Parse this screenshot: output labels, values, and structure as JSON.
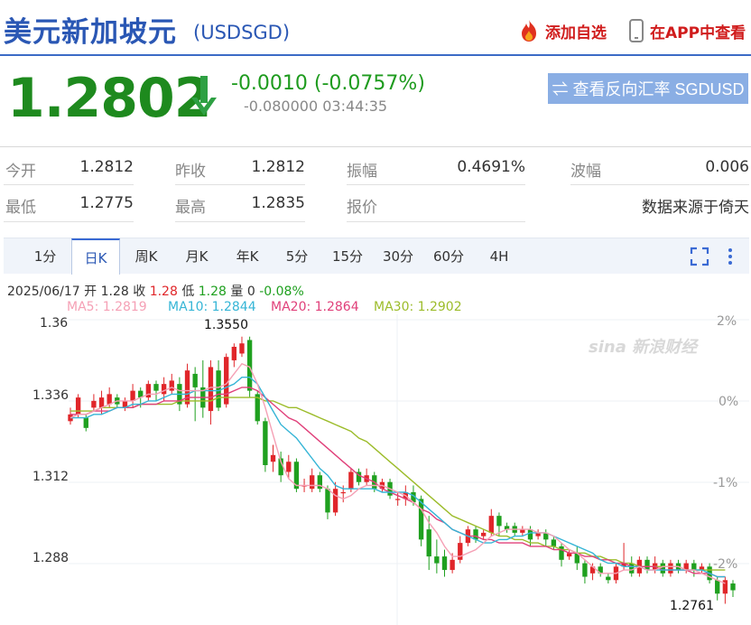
{
  "header": {
    "title": "美元新加坡元",
    "symbol": "(USDSGD)",
    "add_favorite": "添加自选",
    "open_app": "在APP中查看"
  },
  "quote": {
    "price": "1.2802",
    "change": "-0.0010 (-0.0757%)",
    "sub_line": "-0.080000 03:44:35",
    "reverse_button": "⇌ 查看反向汇率 SGDUSD",
    "down_color": "#1e8a1e"
  },
  "stats": {
    "open_label": "今开",
    "open_value": "1.2812",
    "prev_label": "昨收",
    "prev_value": "1.2812",
    "amp_label": "振幅",
    "amp_value": "0.4691%",
    "vol_label": "波幅",
    "vol_value": "0.006",
    "low_label": "最低",
    "low_value": "1.2775",
    "high_label": "最高",
    "high_value": "1.2835",
    "quote_label": "报价",
    "source": "数据来源于倚天"
  },
  "tabs": [
    "1分",
    "日K",
    "周K",
    "月K",
    "年K",
    "5分",
    "15分",
    "30分",
    "60分",
    "4H"
  ],
  "active_tab": "日K",
  "chart_info": {
    "date": "2025/06/17",
    "open_label": "开",
    "open": "1.28",
    "close_label": "收",
    "close": "1.28",
    "low_label": "低",
    "low": "1.28",
    "volume_label": "量",
    "volume": "0",
    "change": "-0.08%"
  },
  "ma_labels": {
    "ma5": "MA5: 1.2819",
    "ma10": "MA10: 1.2844",
    "ma20": "MA20: 1.2864",
    "ma30": "MA30: 1.2902"
  },
  "colors": {
    "up": "#e0262a",
    "down": "#1fa01f",
    "ma5": "#f5a0b5",
    "ma10": "#35b5d6",
    "ma20": "#e0407a",
    "ma30": "#9cbc2a"
  },
  "watermark": "sina 新浪财经",
  "chart_data": {
    "type": "candlestick",
    "y_ticks": [
      "1.36",
      "1.336",
      "1.312",
      "1.288"
    ],
    "right_ticks": [
      "2%",
      "0%",
      "-1%",
      "-2%"
    ],
    "ylim": [
      1.274,
      1.36
    ],
    "max_label": "1.3550",
    "min_label": "1.2761",
    "candles": [
      [
        1.33,
        1.332,
        1.329,
        1.334
      ],
      [
        1.332,
        1.337,
        1.331,
        1.338
      ],
      [
        1.331,
        1.328,
        1.327,
        1.332
      ],
      [
        1.334,
        1.336,
        1.333,
        1.338
      ],
      [
        1.334,
        1.337,
        1.332,
        1.339
      ],
      [
        1.335,
        1.338,
        1.334,
        1.34
      ],
      [
        1.337,
        1.335,
        1.334,
        1.338
      ],
      [
        1.334,
        1.336,
        1.333,
        1.337
      ],
      [
        1.336,
        1.339,
        1.334,
        1.341
      ],
      [
        1.339,
        1.337,
        1.334,
        1.34
      ],
      [
        1.337,
        1.341,
        1.336,
        1.342
      ],
      [
        1.341,
        1.339,
        1.336,
        1.342
      ],
      [
        1.338,
        1.341,
        1.336,
        1.343
      ],
      [
        1.339,
        1.342,
        1.338,
        1.344
      ],
      [
        1.341,
        1.335,
        1.333,
        1.343
      ],
      [
        1.335,
        1.345,
        1.334,
        1.347
      ],
      [
        1.344,
        1.34,
        1.33,
        1.346
      ],
      [
        1.34,
        1.334,
        1.331,
        1.348
      ],
      [
        1.333,
        1.346,
        1.329,
        1.348
      ],
      [
        1.345,
        1.334,
        1.333,
        1.348
      ],
      [
        1.335,
        1.349,
        1.334,
        1.35
      ],
      [
        1.348,
        1.352,
        1.346,
        1.353
      ],
      [
        1.35,
        1.353,
        1.349,
        1.355
      ],
      [
        1.354,
        1.339,
        1.337,
        1.355
      ],
      [
        1.338,
        1.33,
        1.329,
        1.339
      ],
      [
        1.33,
        1.317,
        1.315,
        1.331
      ],
      [
        1.318,
        1.32,
        1.315,
        1.323
      ],
      [
        1.319,
        1.314,
        1.312,
        1.321
      ],
      [
        1.315,
        1.318,
        1.313,
        1.32
      ],
      [
        1.318,
        1.31,
        1.309,
        1.319
      ],
      [
        1.311,
        1.311,
        1.309,
        1.313
      ],
      [
        1.31,
        1.314,
        1.309,
        1.316
      ],
      [
        1.314,
        1.31,
        1.309,
        1.315
      ],
      [
        1.31,
        1.303,
        1.301,
        1.311
      ],
      [
        1.303,
        1.31,
        1.302,
        1.312
      ],
      [
        1.309,
        1.309,
        1.306,
        1.311
      ],
      [
        1.31,
        1.315,
        1.309,
        1.316
      ],
      [
        1.315,
        1.312,
        1.311,
        1.316
      ],
      [
        1.312,
        1.314,
        1.311,
        1.316
      ],
      [
        1.314,
        1.31,
        1.309,
        1.315
      ],
      [
        1.31,
        1.312,
        1.309,
        1.313
      ],
      [
        1.312,
        1.308,
        1.307,
        1.313
      ],
      [
        1.307,
        1.307,
        1.305,
        1.309
      ],
      [
        1.307,
        1.309,
        1.305,
        1.311
      ],
      [
        1.309,
        1.306,
        1.305,
        1.311
      ],
      [
        1.307,
        1.295,
        1.293,
        1.308
      ],
      [
        1.298,
        1.29,
        1.286,
        1.302
      ],
      [
        1.29,
        1.288,
        1.285,
        1.295
      ],
      [
        1.29,
        1.286,
        1.284,
        1.292
      ],
      [
        1.286,
        1.289,
        1.285,
        1.291
      ],
      [
        1.289,
        1.294,
        1.288,
        1.296
      ],
      [
        1.294,
        1.298,
        1.293,
        1.299
      ],
      [
        1.298,
        1.295,
        1.294,
        1.299
      ],
      [
        1.296,
        1.297,
        1.295,
        1.298
      ],
      [
        1.297,
        1.302,
        1.296,
        1.304
      ],
      [
        1.302,
        1.299,
        1.296,
        1.303
      ],
      [
        1.299,
        1.298,
        1.297,
        1.3
      ],
      [
        1.299,
        1.297,
        1.296,
        1.3
      ],
      [
        1.297,
        1.298,
        1.296,
        1.299
      ],
      [
        1.298,
        1.295,
        1.293,
        1.299
      ],
      [
        1.296,
        1.297,
        1.295,
        1.298
      ],
      [
        1.297,
        1.295,
        1.293,
        1.298
      ],
      [
        1.295,
        1.293,
        1.292,
        1.296
      ],
      [
        1.293,
        1.289,
        1.287,
        1.294
      ],
      [
        1.29,
        1.291,
        1.289,
        1.292
      ],
      [
        1.291,
        1.288,
        1.286,
        1.293
      ],
      [
        1.288,
        1.284,
        1.282,
        1.289
      ],
      [
        1.285,
        1.287,
        1.283,
        1.288
      ],
      [
        1.287,
        1.285,
        1.284,
        1.288
      ],
      [
        1.284,
        1.283,
        1.282,
        1.285
      ],
      [
        1.283,
        1.287,
        1.282,
        1.288
      ],
      [
        1.287,
        1.288,
        1.286,
        1.294
      ],
      [
        1.288,
        1.285,
        1.284,
        1.29
      ],
      [
        1.285,
        1.289,
        1.284,
        1.29
      ],
      [
        1.289,
        1.286,
        1.285,
        1.29
      ],
      [
        1.286,
        1.288,
        1.285,
        1.29
      ],
      [
        1.288,
        1.285,
        1.284,
        1.289
      ],
      [
        1.285,
        1.288,
        1.284,
        1.289
      ],
      [
        1.288,
        1.286,
        1.285,
        1.289
      ],
      [
        1.286,
        1.288,
        1.285,
        1.289
      ],
      [
        1.288,
        1.286,
        1.284,
        1.289
      ],
      [
        1.286,
        1.287,
        1.285,
        1.288
      ],
      [
        1.287,
        1.283,
        1.282,
        1.288
      ],
      [
        1.283,
        1.279,
        1.277,
        1.284
      ],
      [
        1.279,
        1.283,
        1.276,
        1.284
      ],
      [
        1.282,
        1.28,
        1.278,
        1.283
      ]
    ],
    "ma5": [
      1.331,
      1.332,
      1.332,
      1.333,
      1.334,
      1.335,
      1.336,
      1.336,
      1.336,
      1.337,
      1.338,
      1.338,
      1.339,
      1.34,
      1.339,
      1.339,
      1.339,
      1.339,
      1.34,
      1.34,
      1.341,
      1.344,
      1.347,
      1.346,
      1.341,
      1.334,
      1.326,
      1.318,
      1.313,
      1.311,
      1.311,
      1.311,
      1.311,
      1.31,
      1.308,
      1.307,
      1.308,
      1.31,
      1.311,
      1.311,
      1.311,
      1.31,
      1.309,
      1.308,
      1.306,
      1.304,
      1.3,
      1.297,
      1.293,
      1.29,
      1.29,
      1.291,
      1.292,
      1.294,
      1.296,
      1.297,
      1.298,
      1.298,
      1.298,
      1.298,
      1.297,
      1.297,
      1.296,
      1.294,
      1.292,
      1.291,
      1.289,
      1.287,
      1.285,
      1.285,
      1.285,
      1.286,
      1.286,
      1.287,
      1.286,
      1.286,
      1.287,
      1.287,
      1.287,
      1.286,
      1.286,
      1.285,
      1.284,
      1.283,
      1.282
    ],
    "ma10": [
      1.331,
      1.331,
      1.331,
      1.332,
      1.332,
      1.333,
      1.334,
      1.334,
      1.335,
      1.335,
      1.336,
      1.336,
      1.337,
      1.338,
      1.338,
      1.338,
      1.339,
      1.339,
      1.339,
      1.339,
      1.34,
      1.341,
      1.343,
      1.343,
      1.341,
      1.337,
      1.333,
      1.329,
      1.327,
      1.325,
      1.322,
      1.319,
      1.316,
      1.314,
      1.311,
      1.31,
      1.31,
      1.31,
      1.31,
      1.31,
      1.309,
      1.309,
      1.309,
      1.309,
      1.308,
      1.306,
      1.304,
      1.302,
      1.3,
      1.298,
      1.297,
      1.296,
      1.295,
      1.294,
      1.294,
      1.295,
      1.295,
      1.296,
      1.296,
      1.297,
      1.297,
      1.297,
      1.296,
      1.295,
      1.294,
      1.293,
      1.292,
      1.291,
      1.289,
      1.288,
      1.288,
      1.287,
      1.287,
      1.287,
      1.286,
      1.286,
      1.286,
      1.286,
      1.286,
      1.286,
      1.286,
      1.286,
      1.285,
      1.284,
      1.284
    ],
    "ma20": [
      1.332,
      1.332,
      1.332,
      1.333,
      1.333,
      1.333,
      1.334,
      1.334,
      1.334,
      1.335,
      1.335,
      1.335,
      1.336,
      1.336,
      1.336,
      1.337,
      1.337,
      1.337,
      1.337,
      1.338,
      1.338,
      1.339,
      1.34,
      1.34,
      1.339,
      1.337,
      1.335,
      1.333,
      1.331,
      1.33,
      1.328,
      1.326,
      1.324,
      1.322,
      1.32,
      1.318,
      1.316,
      1.314,
      1.313,
      1.312,
      1.31,
      1.309,
      1.308,
      1.307,
      1.306,
      1.304,
      1.303,
      1.301,
      1.3,
      1.298,
      1.297,
      1.296,
      1.296,
      1.295,
      1.295,
      1.294,
      1.294,
      1.294,
      1.294,
      1.293,
      1.293,
      1.293,
      1.292,
      1.292,
      1.291,
      1.291,
      1.29,
      1.29,
      1.289,
      1.289,
      1.288,
      1.288,
      1.287,
      1.287,
      1.287,
      1.287,
      1.286,
      1.286,
      1.286,
      1.286,
      1.285,
      1.285,
      1.285,
      1.284,
      1.284
    ],
    "ma30": [
      1.333,
      1.333,
      1.333,
      1.333,
      1.334,
      1.334,
      1.334,
      1.334,
      1.334,
      1.335,
      1.335,
      1.335,
      1.335,
      1.335,
      1.336,
      1.336,
      1.336,
      1.336,
      1.336,
      1.337,
      1.337,
      1.337,
      1.337,
      1.337,
      1.337,
      1.336,
      1.336,
      1.335,
      1.334,
      1.334,
      1.333,
      1.332,
      1.331,
      1.33,
      1.329,
      1.328,
      1.327,
      1.325,
      1.324,
      1.322,
      1.32,
      1.318,
      1.316,
      1.314,
      1.312,
      1.31,
      1.308,
      1.306,
      1.304,
      1.302,
      1.301,
      1.3,
      1.299,
      1.298,
      1.297,
      1.296,
      1.296,
      1.295,
      1.295,
      1.294,
      1.294,
      1.293,
      1.293,
      1.292,
      1.292,
      1.291,
      1.291,
      1.29,
      1.29,
      1.289,
      1.289,
      1.288,
      1.288,
      1.287,
      1.287,
      1.287,
      1.287,
      1.287,
      1.287,
      1.286,
      1.286,
      1.286,
      1.286,
      1.286,
      1.286
    ]
  }
}
